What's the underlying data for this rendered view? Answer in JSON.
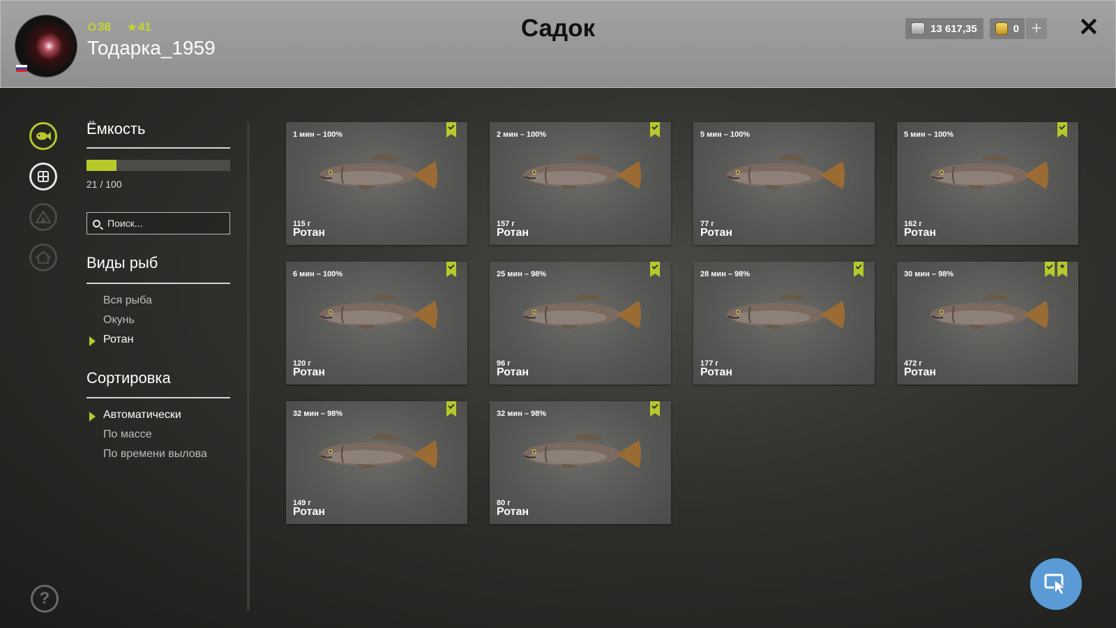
{
  "header": {
    "title": "Садок",
    "username": "Тодарка_1959",
    "level": "38",
    "rank": "41",
    "silver": "13 617,35",
    "gold": "0",
    "plus_label": "+",
    "close_label": "✕"
  },
  "capacity": {
    "heading": "Ёмкость",
    "current": 21,
    "max": 100,
    "text": "21 / 100"
  },
  "search": {
    "placeholder": "Поиск..."
  },
  "species": {
    "heading": "Виды рыб",
    "items": [
      "Вся рыба",
      "Окунь",
      "Ротан"
    ],
    "selected": "Ротан"
  },
  "sort": {
    "heading": "Сортировка",
    "items": [
      "Автоматически",
      "По массе",
      "По времени вылова"
    ],
    "selected": "Автоматически"
  },
  "fish": [
    {
      "time": "1 мин – 100%",
      "weight": "115 г",
      "name": "Ротан",
      "marks": [
        "check"
      ]
    },
    {
      "time": "2 мин – 100%",
      "weight": "157 г",
      "name": "Ротан",
      "marks": [
        "check"
      ]
    },
    {
      "time": "5 мин – 100%",
      "weight": "77 г",
      "name": "Ротан",
      "marks": []
    },
    {
      "time": "5 мин – 100%",
      "weight": "162 г",
      "name": "Ротан",
      "marks": [
        "check"
      ]
    },
    {
      "time": "6 мин – 100%",
      "weight": "120 г",
      "name": "Ротан",
      "marks": [
        "check"
      ]
    },
    {
      "time": "25 мин – 98%",
      "weight": "96 г",
      "name": "Ротан",
      "marks": [
        "check"
      ]
    },
    {
      "time": "28 мин – 98%",
      "weight": "177 г",
      "name": "Ротан",
      "marks": [
        "check"
      ]
    },
    {
      "time": "30 мин – 98%",
      "weight": "472 г",
      "name": "Ротан",
      "marks": [
        "check",
        "star"
      ]
    },
    {
      "time": "32 мин – 98%",
      "weight": "149 г",
      "name": "Ротан",
      "marks": [
        "check"
      ]
    },
    {
      "time": "32 мин – 98%",
      "weight": "80 г",
      "name": "Ротан",
      "marks": [
        "check"
      ]
    }
  ],
  "colors": {
    "accent": "#b7c92b",
    "cursor_button": "#5b9bd5"
  },
  "icons": {
    "rail": [
      "fish-icon",
      "keepnet-icon",
      "tent-icon",
      "home-icon"
    ],
    "help": "help-icon",
    "cursor": "cursor-icon"
  }
}
